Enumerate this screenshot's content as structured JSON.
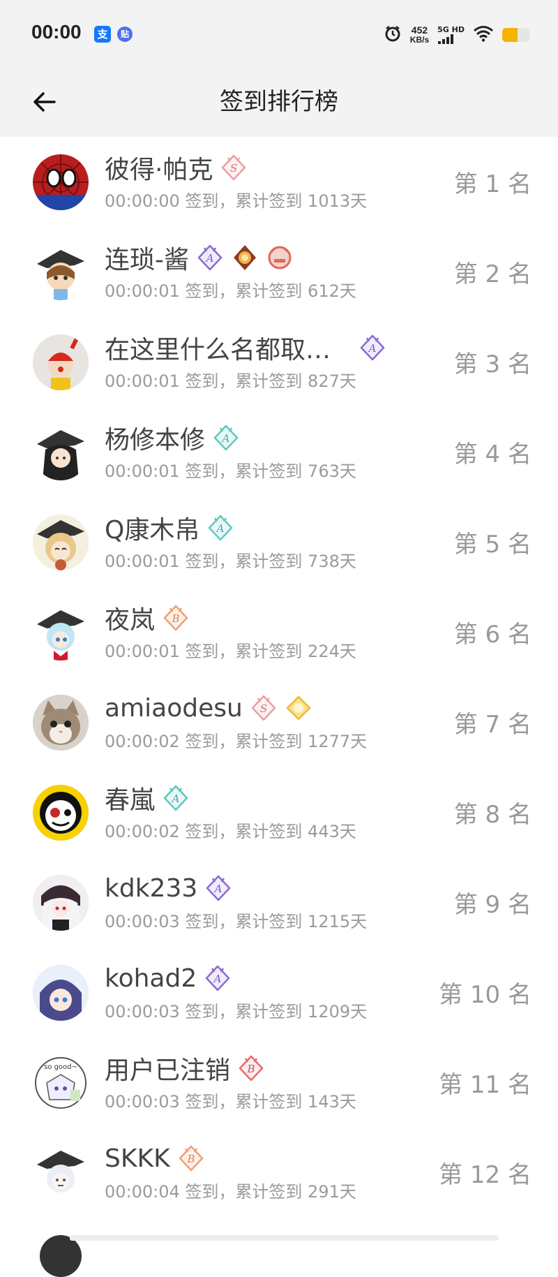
{
  "status_bar": {
    "time": "00:00",
    "net_speed_value": "452",
    "net_speed_unit": "KB/s",
    "net_type": "5G HD",
    "app_badge_1": "支",
    "app_badge_2": "贴",
    "battery_level": 0.55,
    "colors": {
      "battery": "#f4b400",
      "alipay": "#1677ff",
      "tieba": "#4e6ef2"
    }
  },
  "header": {
    "title": "签到排行榜"
  },
  "rows": [
    {
      "name": "彼得·帕克",
      "sub": "00:00:00 签到，累计签到 1013天",
      "rank": "第 1 名",
      "avatar": "spiderman-avatar",
      "badges": [
        "S"
      ]
    },
    {
      "name": "连琐-酱",
      "sub": "00:00:01 签到，累计签到 612天",
      "rank": "第 2 名",
      "avatar": "anime-girl-avatar",
      "badges": [
        "A-purple",
        "medal-gold",
        "medal-red"
      ]
    },
    {
      "name": "在这里什么名都取…",
      "sub": "00:00:01 签到，累计签到 827天",
      "rank": "第 3 名",
      "avatar": "clown-avatar",
      "badges": [
        "A-purple"
      ]
    },
    {
      "name": "杨修本修",
      "sub": "00:00:01 签到，累计签到 763天",
      "rank": "第 4 名",
      "avatar": "anime-dark-avatar",
      "badges": [
        "A-teal"
      ]
    },
    {
      "name": "Q康木帛",
      "sub": "00:00:01 签到，累计签到 738天",
      "rank": "第 5 名",
      "avatar": "anime-blonde-avatar",
      "badges": [
        "A-teal"
      ]
    },
    {
      "name": "夜岚",
      "sub": "00:00:01 签到，累计签到 224天",
      "rank": "第 6 名",
      "avatar": "anime-blue-avatar",
      "badges": [
        "B"
      ]
    },
    {
      "name": "amiaodesu",
      "sub": "00:00:02 签到，累计签到 1277天",
      "rank": "第 7 名",
      "avatar": "cat-avatar",
      "badges": [
        "S",
        "medal-yellow"
      ]
    },
    {
      "name": "春嵐",
      "sub": "00:00:02 签到，累计签到 443天",
      "rank": "第 8 名",
      "avatar": "mask-avatar",
      "badges": [
        "A-teal"
      ]
    },
    {
      "name": "kdk233",
      "sub": "00:00:03 签到，累计签到 1215天",
      "rank": "第 9 名",
      "avatar": "anime-white-hair-avatar",
      "badges": [
        "A-purple"
      ]
    },
    {
      "name": "kohad2",
      "sub": "00:00:03 签到，累计签到 1209天",
      "rank": "第 10 名",
      "avatar": "anime-purple-avatar",
      "badges": [
        "A-purple"
      ]
    },
    {
      "name": "用户已注销",
      "sub": "00:00:03 签到，累计签到 143天",
      "rank": "第 11 名",
      "avatar": "sticker-avatar",
      "badges": [
        "B-red"
      ]
    },
    {
      "name": "SKKK",
      "sub": "00:00:04 签到，累计签到 291天",
      "rank": "第 12 名",
      "avatar": "anime-white-avatar",
      "badges": [
        "B"
      ]
    }
  ]
}
